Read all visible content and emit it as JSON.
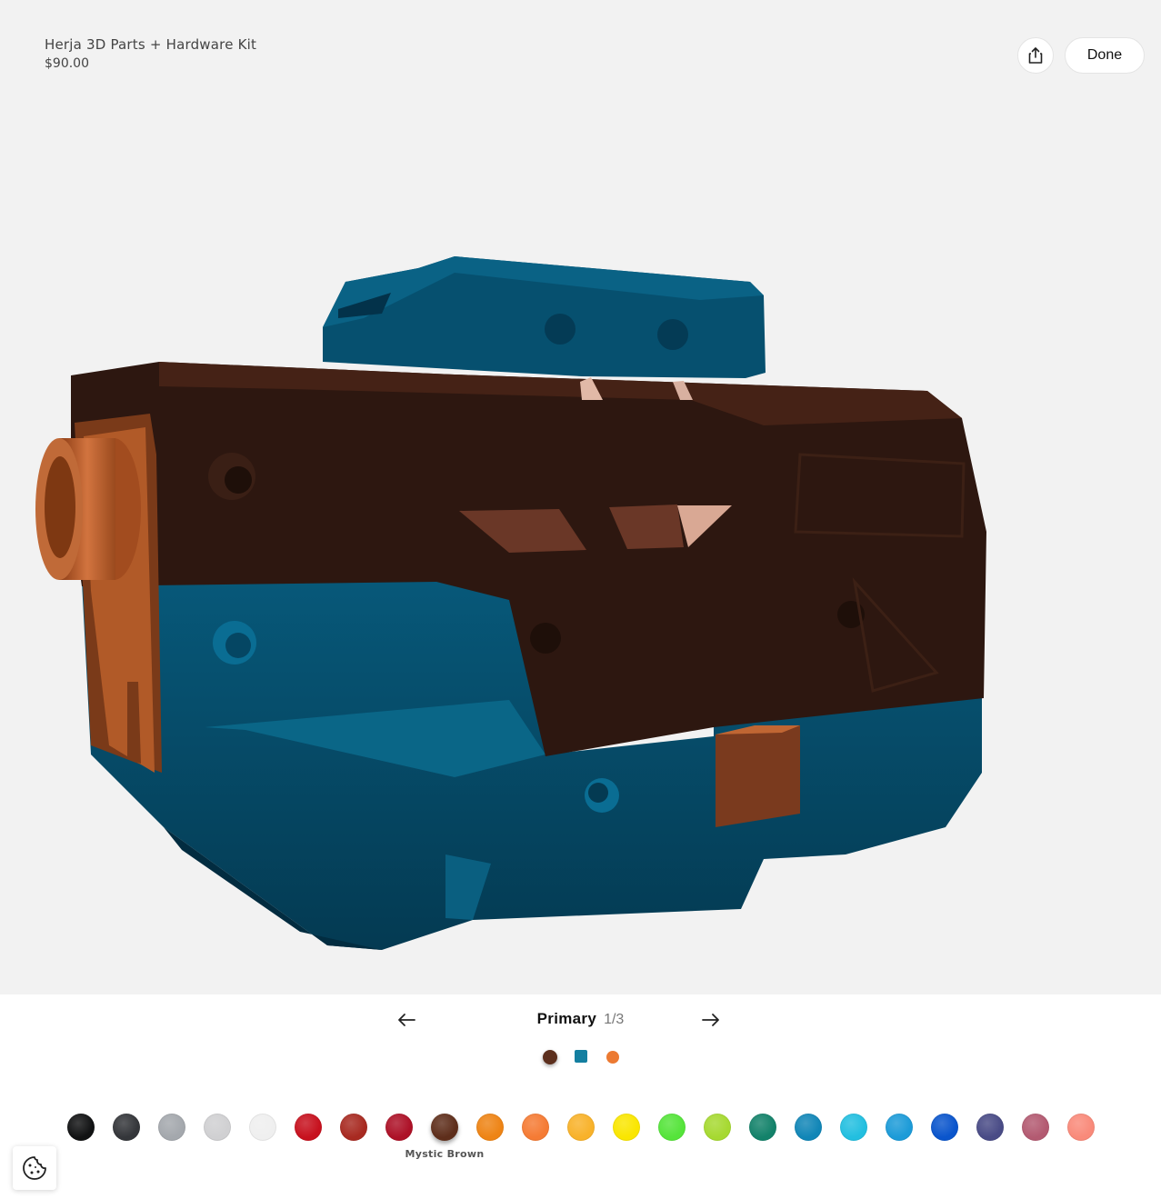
{
  "product": {
    "name": "Herja 3D Parts + Hardware Kit",
    "price": "$90.00"
  },
  "header": {
    "share_icon": "share-icon",
    "done_label": "Done"
  },
  "part_selector": {
    "name": "Primary",
    "count": "1/3",
    "parts": [
      {
        "color": "#5c2f1d",
        "shape": "round",
        "selected": true
      },
      {
        "color": "#147fa0",
        "shape": "square",
        "selected": false
      },
      {
        "color": "#ec7a32",
        "shape": "round",
        "selected": false
      }
    ]
  },
  "palette": {
    "selected_label": "Mystic Brown",
    "colors": [
      "#111213",
      "#34363a",
      "#a4a8ad",
      "#d0d0d2",
      "#efefef",
      "#c7111e",
      "#a82a21",
      "#ad1127",
      "#5e2e1b",
      "#ee8415",
      "#f57b34",
      "#f8b22a",
      "#fae600",
      "#55e43a",
      "#a6d931",
      "#13826a",
      "#1186b7",
      "#22bfe0",
      "#1c9bd8",
      "#0a55cc",
      "#494b86",
      "#b35a71",
      "#f98a7a"
    ],
    "selected_index": 8
  },
  "cookie": {
    "icon": "cookie-icon"
  }
}
